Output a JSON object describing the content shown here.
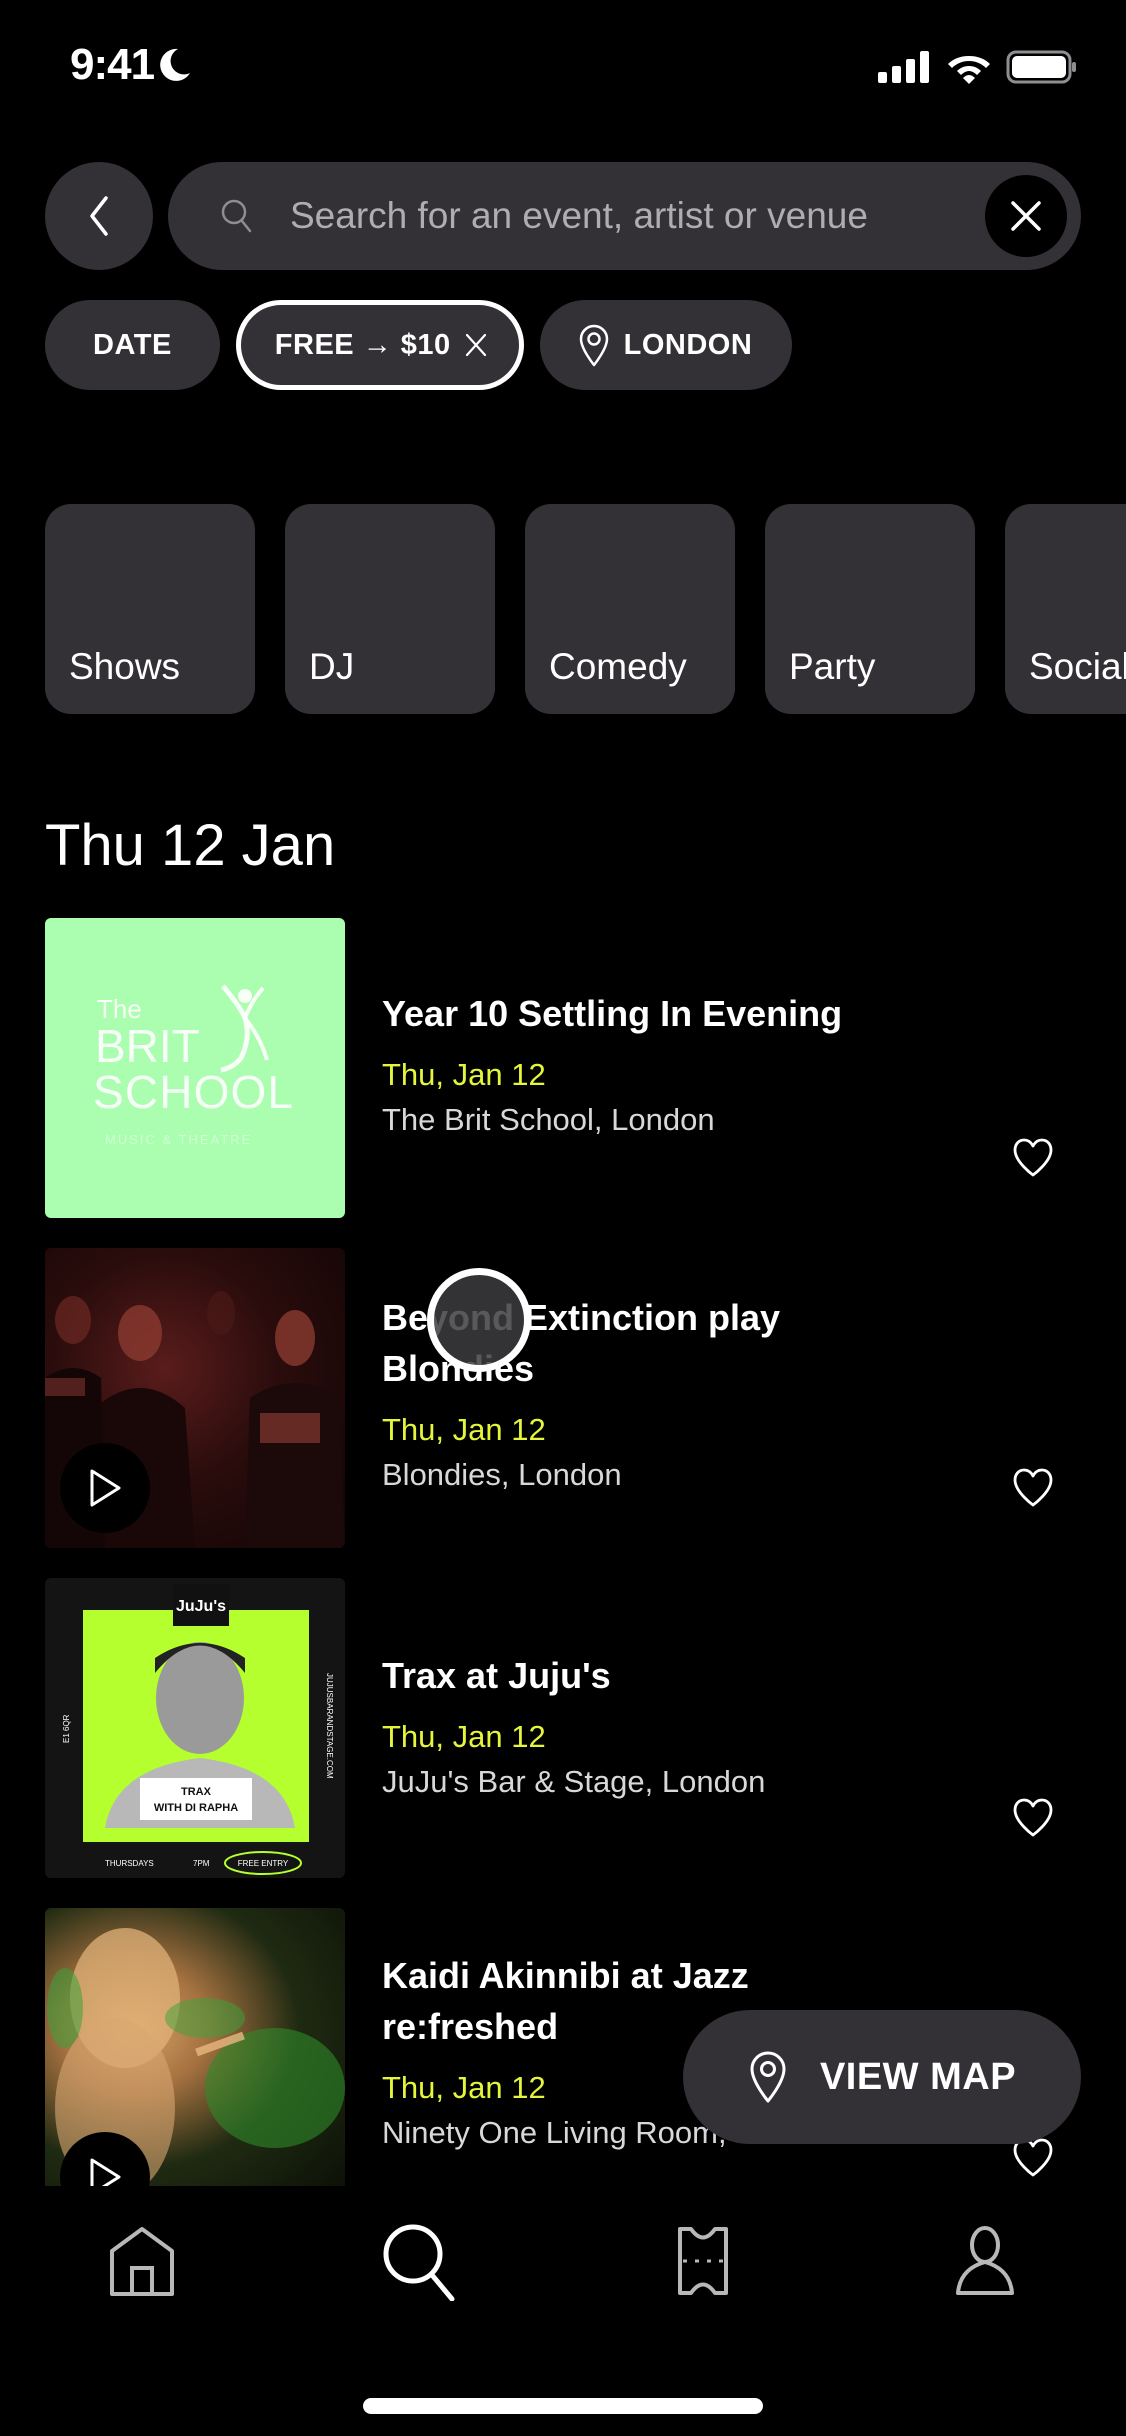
{
  "status_bar": {
    "time": "9:41",
    "focus_icon": "moon-icon",
    "icons": [
      "cellular-signal-icon",
      "wifi-icon",
      "battery-icon"
    ]
  },
  "search": {
    "back_icon": "chevron-left-icon",
    "search_icon": "search-icon",
    "placeholder": "Search for an event, artist or venue",
    "value": "",
    "clear_icon": "close-icon"
  },
  "filters": {
    "date_label": "DATE",
    "price_label": "FREE → $10",
    "price_remove_icon": "close-icon",
    "location_icon": "location-pin-icon",
    "location_label": "LONDON"
  },
  "categories": [
    {
      "label": "Shows"
    },
    {
      "label": "DJ"
    },
    {
      "label": "Comedy"
    },
    {
      "label": "Party"
    },
    {
      "label": "Social"
    }
  ],
  "section": {
    "title": "Thu 12 Jan"
  },
  "events": [
    {
      "title": "Year 10 Settling In Evening",
      "date": "Thu, Jan 12",
      "venue": "The Brit School, London",
      "thumb_text": [
        "The",
        "BRIT",
        "SCHOOL",
        "MUSIC & THEATRE"
      ],
      "has_play": false
    },
    {
      "title": "Beyond Extinction play Blondies",
      "date": "Thu, Jan 12",
      "venue": "Blondies, London",
      "has_play": true
    },
    {
      "title": "Trax at Juju's",
      "date": "Thu, Jan 12",
      "venue": "JuJu's Bar & Stage, London",
      "thumb_text": {
        "logo": "JuJu's",
        "caption_line1": "TRAX",
        "caption_line2": "WITH DI RAPHA",
        "footer_day": "THURSDAYS",
        "footer_time": "7PM",
        "footer_entry": "FREE ENTRY",
        "side_left": "E1 6QR",
        "side_right": "JUJUSBARANDSTAGE.COM"
      },
      "has_play": false
    },
    {
      "title": "Kaidi Akinnibi at Jazz re:freshed",
      "date": "Thu, Jan 12",
      "venue": "Ninety One Living Room, London",
      "has_play": true
    }
  ],
  "view_map": {
    "icon": "location-pin-icon",
    "label": "VIEW MAP"
  },
  "tab_bar": {
    "tabs": [
      {
        "name": "home",
        "icon": "home-icon",
        "active": false
      },
      {
        "name": "search",
        "icon": "search-icon",
        "active": true
      },
      {
        "name": "tickets",
        "icon": "ticket-icon",
        "active": false
      },
      {
        "name": "profile",
        "icon": "profile-icon",
        "active": false
      }
    ]
  },
  "colors": {
    "background": "#000000",
    "surface": "#333135",
    "accent_date": "#e4f53a",
    "brit_thumb": "#abfdb0",
    "juju_green": "#b6ff2e"
  }
}
